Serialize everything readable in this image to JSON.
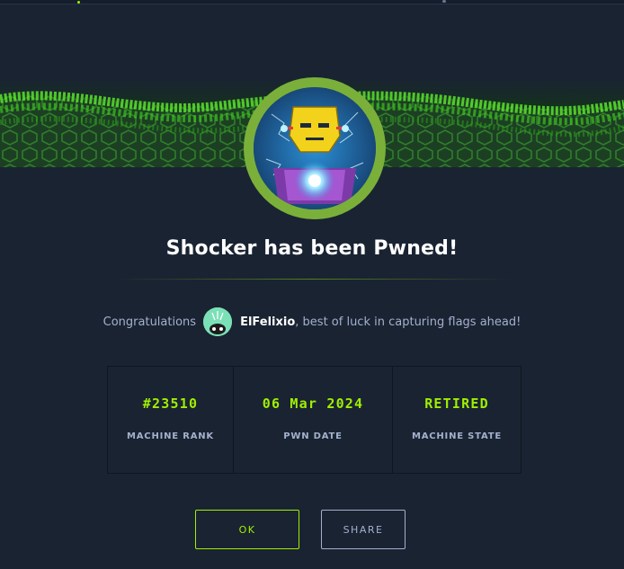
{
  "title": "Shocker has been Pwned!",
  "congrats": {
    "prefix": "Congratulations",
    "username": "ElFelixio",
    "suffix": ", best of luck in capturing flags ahead!"
  },
  "stats": [
    {
      "value": "#23510",
      "label": "MACHINE RANK"
    },
    {
      "value": "06 Mar 2024",
      "label": "PWN DATE"
    },
    {
      "value": "RETIRED",
      "label": "MACHINE STATE"
    }
  ],
  "buttons": {
    "ok": "OK",
    "share": "SHARE"
  },
  "colors": {
    "background": "#1a2332",
    "accent": "#9fef00",
    "text": "#a4b1cd"
  }
}
